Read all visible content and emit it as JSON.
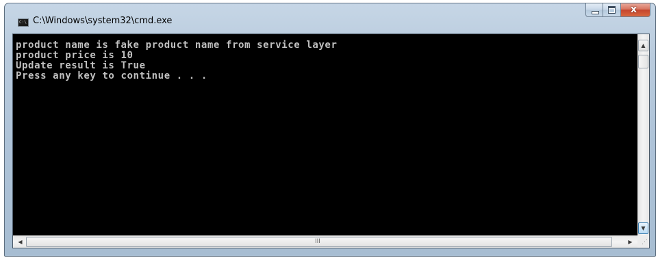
{
  "window": {
    "title": "C:\\Windows\\system32\\cmd.exe",
    "icon": "cmd-console-icon",
    "icon_text": "C:\\"
  },
  "caption_buttons": {
    "minimize_icon": "minimize-icon",
    "maximize_icon": "maximize-icon",
    "close_glyph": "x"
  },
  "console": {
    "background_color": "#000000",
    "text_color": "#c0c0c0",
    "lines": [
      "product name is fake product name from service layer",
      "product price is 10",
      "Update result is True",
      "Press any key to continue . . ."
    ]
  },
  "scrollbars": {
    "up_arrow": "▲",
    "down_arrow": "▼",
    "left_arrow": "◀",
    "right_arrow": "▶",
    "grip": "III",
    "size_grip": "⋰"
  }
}
